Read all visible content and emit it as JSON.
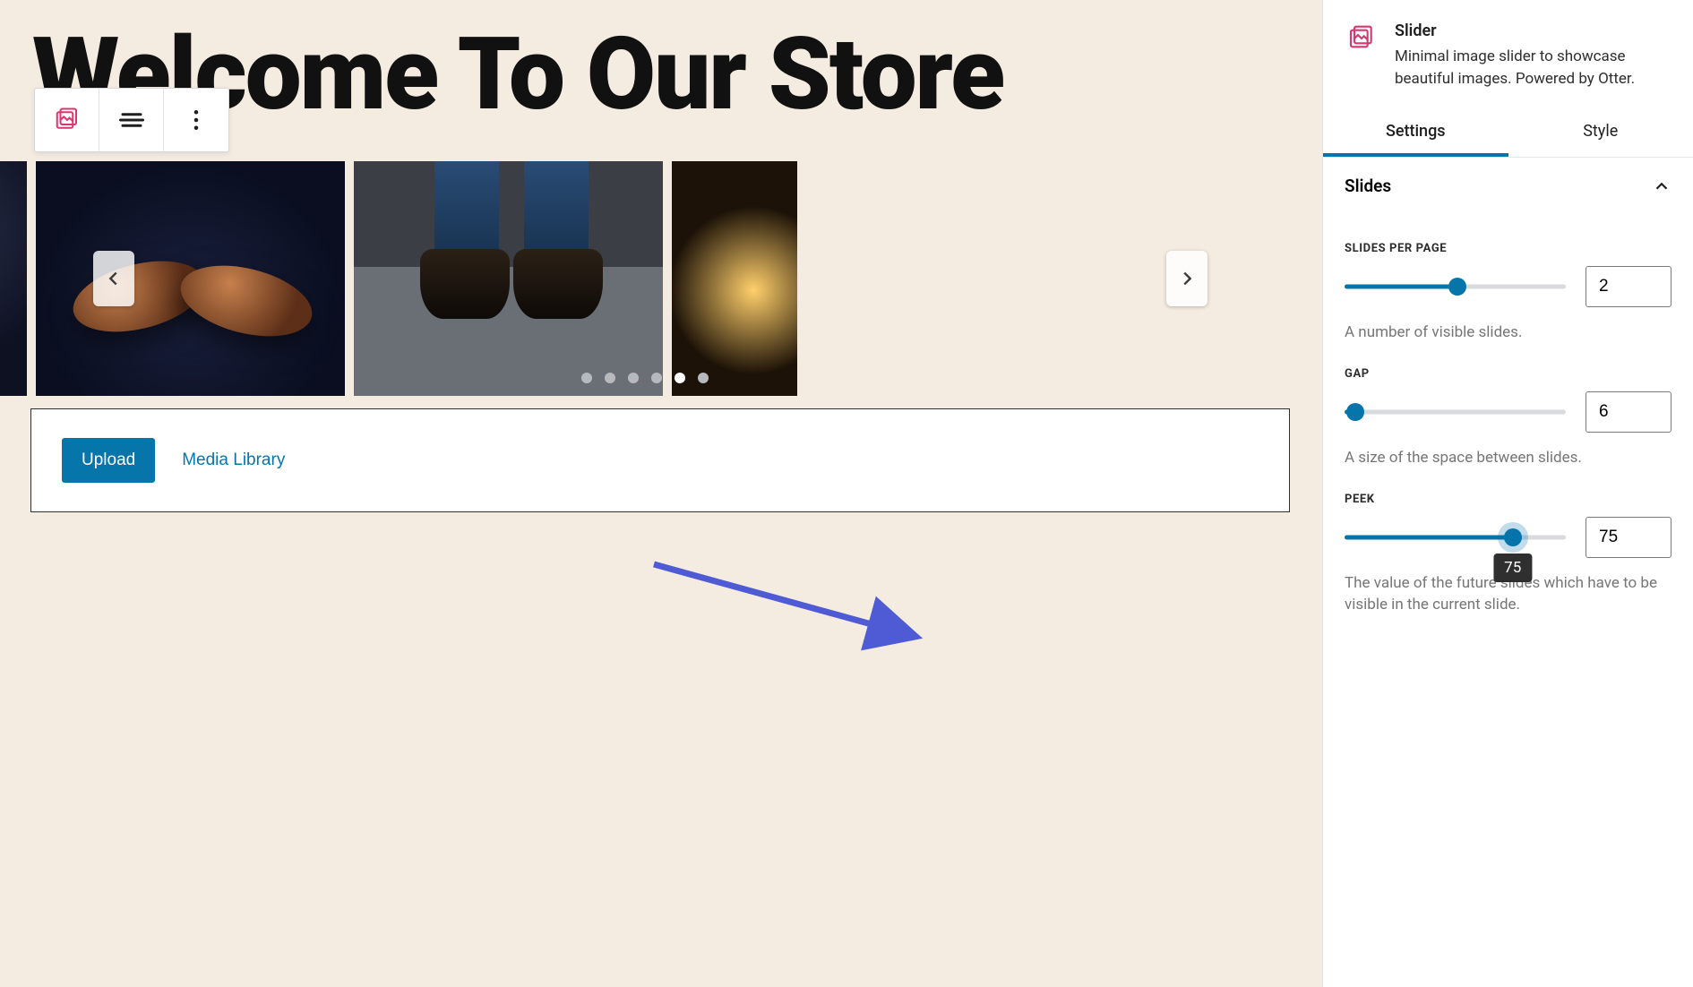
{
  "page": {
    "title": "Welcome To Our Store"
  },
  "toolbar": {
    "block_icon": "slider-icon",
    "align_icon": "align-icon",
    "more_icon": "more-icon"
  },
  "slider": {
    "prev_label": "Previous",
    "next_label": "Next",
    "dot_count": 6,
    "active_dot": 4
  },
  "media_box": {
    "upload_label": "Upload",
    "library_label": "Media Library"
  },
  "sidebar": {
    "block_title": "Slider",
    "block_desc": "Minimal image slider to showcase beautiful images. Powered by Otter.",
    "tabs": {
      "settings": "Settings",
      "style": "Style",
      "active": "settings"
    },
    "panel": {
      "title": "Slides",
      "controls": {
        "slides_per_page": {
          "label": "SLIDES PER PAGE",
          "value": "2",
          "desc": "A number of visible slides.",
          "percent": 51
        },
        "gap": {
          "label": "GAP",
          "value": "6",
          "desc": "A size of the space between slides.",
          "percent": 5
        },
        "peek": {
          "label": "PEEK",
          "value": "75",
          "desc": "The value of the future slides which have to be visible in the current slide.",
          "percent": 76,
          "tooltip": "75"
        }
      }
    }
  }
}
